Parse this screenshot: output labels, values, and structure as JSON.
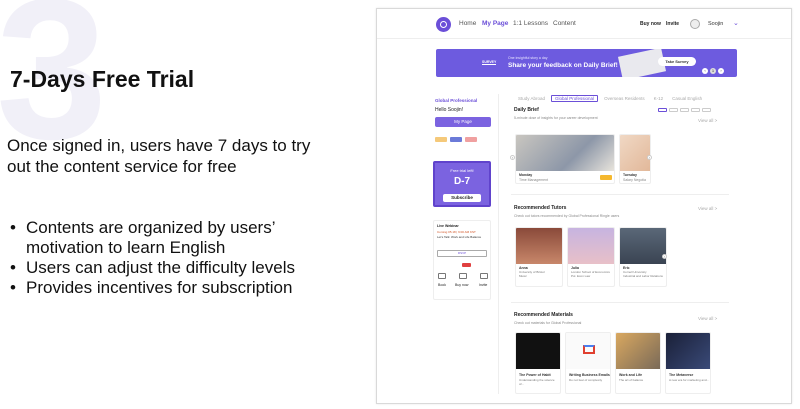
{
  "slide": {
    "big_number": "3",
    "heading": "7-Days Free Trial",
    "intro": "Once signed in, users have 7 days to try out the content service for free",
    "bullets": [
      "Contents are organized by users’ motivation to learn English",
      "Users can adjust the difficulty levels",
      "Provides incentives for subscription"
    ]
  },
  "app": {
    "nav": [
      "Home",
      "My Page",
      "1:1 Lessons",
      "Content"
    ],
    "active_nav": "My Page",
    "buy_now": "Buy now",
    "invite": "Invite",
    "username": "Soojin",
    "banner": {
      "tag": "SURVEY",
      "small": "One insightful story a day",
      "title": "Share your feedback on Daily Brief!",
      "button": "Take Survey",
      "page": "1"
    },
    "sidebar": {
      "program": "Global Professional",
      "hello": "Hello Soojin!",
      "my_page": "My Page",
      "trial_title": "Free trial left!",
      "trial_days": "D-7",
      "subscribe": "Subscribe",
      "webinar_title": "Live Webinar",
      "webinar_date": "Coming 05.18 | 9:00 AM KST",
      "webinar_desc": "Let's Talk: Work and Life Balance",
      "webinar_button": "RSVP",
      "shortcuts": [
        "Book",
        "Buy now",
        "Invite"
      ]
    },
    "tabs": [
      "Study Abroad",
      "Global Professional",
      "Overseas Residents",
      "K-12",
      "Casual English"
    ],
    "active_tab": "Global Professional",
    "view_all": "View all >",
    "daily": {
      "title": "Daily Brief",
      "sub": "5-minute dose of insights for your career development",
      "cards": [
        {
          "day": "Monday",
          "topic": "Time Management"
        },
        {
          "day": "Tuesday",
          "topic": "Salary Negotia"
        }
      ]
    },
    "tutors": {
      "title": "Recommended Tutors",
      "sub": "Check out tutors recommended by Global Professional Ringle users",
      "cards": [
        {
          "name": "Anna",
          "school": "University of Bristol",
          "major": "Music"
        },
        {
          "name": "Julia",
          "school": "London School of Economics",
          "major": "Pol. Econ Law"
        },
        {
          "name": "Eric",
          "school": "Cornell University",
          "major": "Industrial and Labor Relations"
        }
      ]
    },
    "materials": {
      "title": "Recommended Materials",
      "sub": "Check out materials for Global Professional",
      "cards": [
        {
          "title": "The Power of Habit",
          "desc": "Understanding the science of..."
        },
        {
          "title": "Writing Business Emails",
          "desc": "Do not fear of complexity"
        },
        {
          "title": "Work and Life",
          "desc": "The art of balance"
        },
        {
          "title": "The Metaverse",
          "desc": "A new era for marketing and..."
        }
      ]
    }
  },
  "colors": {
    "accent": "#6b4fd8",
    "banner": "#6d5bdf",
    "trial": "#7b63e0"
  }
}
